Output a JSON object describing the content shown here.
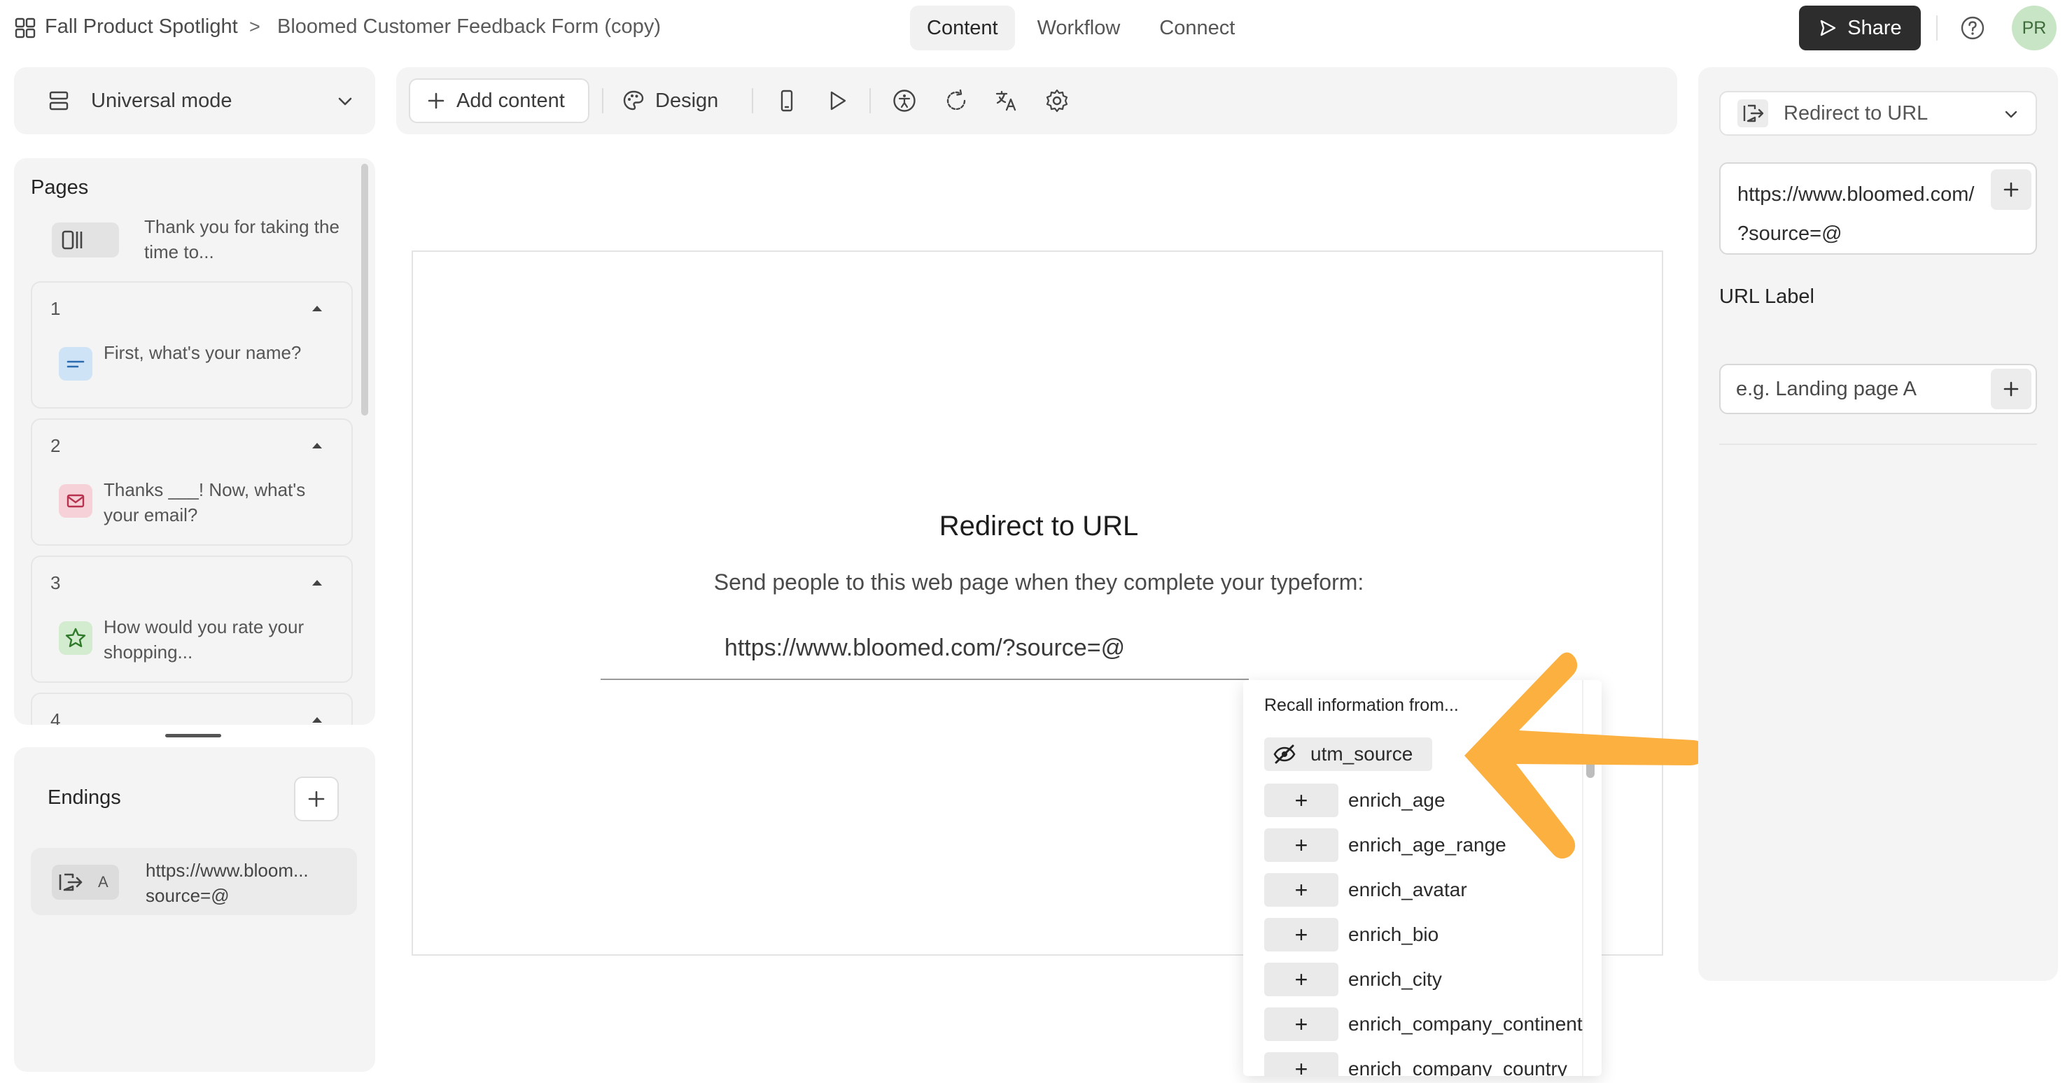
{
  "header": {
    "workspace": "Fall Product Spotlight",
    "separator": ">",
    "form_title": "Bloomed Customer Feedback Form (copy)",
    "tabs": [
      {
        "label": "Content",
        "active": true
      },
      {
        "label": "Workflow",
        "active": false
      },
      {
        "label": "Connect",
        "active": false
      }
    ],
    "share_label": "Share",
    "avatar_initials": "PR"
  },
  "sidebar": {
    "mode_label": "Universal mode",
    "pages_title": "Pages",
    "welcome_text": "Thank you for taking the time to...",
    "questions": [
      {
        "number": "1",
        "text": "First, what's your name?",
        "icon": "short-text-icon",
        "color": "#cfe3f7"
      },
      {
        "number": "2",
        "text": "Thanks ___! Now, what's your email?",
        "icon": "email-icon",
        "color": "#f6d1d8"
      },
      {
        "number": "3",
        "text": "How would you rate your shopping...",
        "icon": "star-icon",
        "color": "#d3ebcf"
      },
      {
        "number": "4",
        "text": "",
        "icon": "",
        "color": "#f4f4f4"
      }
    ],
    "endings_title": "Endings",
    "ending_letter": "A",
    "ending_text_line1": "https://www.bloom...",
    "ending_text_line2": "source=@"
  },
  "toolbar": {
    "add_content_label": "Add content",
    "design_label": "Design",
    "icons": [
      "mobile-preview-icon",
      "play-icon",
      "accessibility-icon",
      "refresh-icon",
      "translate-icon",
      "settings-icon"
    ]
  },
  "preview": {
    "title": "Redirect to URL",
    "description": "Send people to this web page when they complete your typeform:",
    "url": "https://www.bloomed.com/?source=@"
  },
  "recall": {
    "title": "Recall information from...",
    "first_item": "utm_source",
    "items": [
      "enrich_age",
      "enrich_age_range",
      "enrich_avatar",
      "enrich_bio",
      "enrich_city",
      "enrich_company_continent",
      "enrich_company_country"
    ]
  },
  "right_panel": {
    "type_label": "Redirect to URL",
    "url_line1": "https://www.bloomed.com/",
    "url_line2": "?source=@",
    "url_label_title": "URL Label",
    "url_label_placeholder": "e.g. Landing page A"
  },
  "colors": {
    "accent_dark": "#2d2d2d",
    "arrow": "#fbb040",
    "avatar_bg": "#c8e6c6"
  }
}
